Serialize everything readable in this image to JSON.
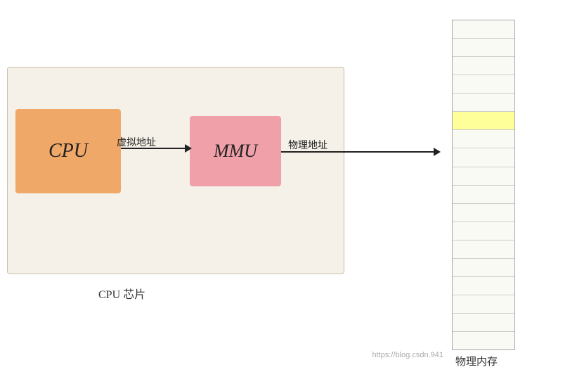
{
  "cpu_chip": {
    "label": "CPU 芯片"
  },
  "cpu_box": {
    "label": "CPU"
  },
  "mmu_box": {
    "label": "MMU"
  },
  "arrows": {
    "virtual_address": "虚拟地址",
    "physical_address": "物理地址"
  },
  "memory": {
    "label": "物理内存",
    "rows": 18,
    "highlighted_row": 5
  },
  "watermark": {
    "text": "https://blog.csdn.941"
  },
  "colors": {
    "cpu_orange": "#f0a868",
    "mmu_pink": "#f0a0a8",
    "memory_highlight": "#ffff99",
    "chip_area_bg": "#f5f0e8"
  }
}
